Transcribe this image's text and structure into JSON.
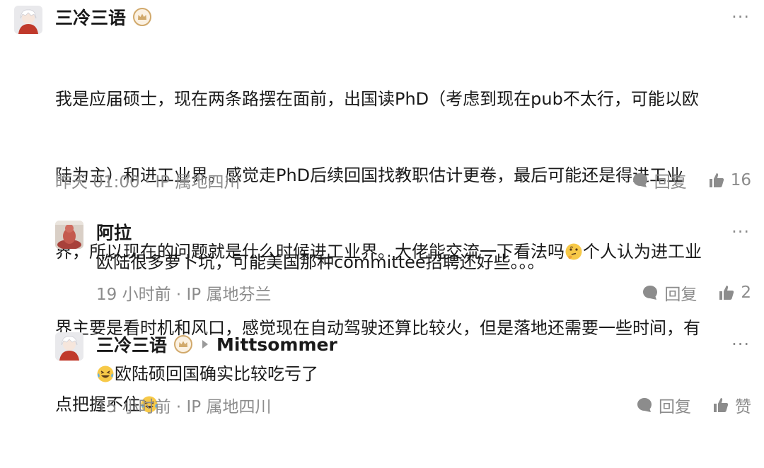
{
  "colors": {
    "text": "#1a1a1a",
    "muted": "#8c8c8c",
    "badge": "#d1a96b"
  },
  "comments": [
    {
      "author": "三冷三语",
      "badge_icon": "crown-badge-icon",
      "more": "···",
      "text_line1": "我是应届硕士，现在两条路摆在面前，出国读PhD（考虑到现在pub不太行，可能以欧",
      "text_line2": "陆为主）和进工业界。感觉走PhD后续回国找教职估计更卷，最后可能还是得进工业",
      "text_line3": "界，所以现在的问题就是什么时候进工业界。大佬能交流一下看法吗",
      "text_line3_tail": "个人认为进工业",
      "text_line4": "界主要是看时机和风口，感觉现在自动驾驶还算比较火，但是落地还需要一些时间，有",
      "text_line5": "点把握不住",
      "emoji_1": "thinking-face-emoji",
      "emoji_2": "laughing-tears-emoji",
      "meta": "昨天 01:00 · IP 属地四川",
      "reply_label": "回复",
      "like_count": "16"
    },
    {
      "author": "阿拉",
      "more": "···",
      "text": "欧陆很多萝卜坑，可能美国那种committee招聘还好些。。。",
      "meta": "19 小时前 · IP 属地芬兰",
      "reply_label": "回复",
      "like_count": "2"
    },
    {
      "author": "三冷三语",
      "badge_icon": "crown-badge-icon",
      "reply_to": "Mittsommer",
      "more": "···",
      "text": "欧陆硕回国确实比较吃亏了",
      "emoji": "laughing-tears-emoji",
      "meta": "15 小时前 · IP 属地四川",
      "reply_label": "回复",
      "like_label": "赞"
    }
  ]
}
